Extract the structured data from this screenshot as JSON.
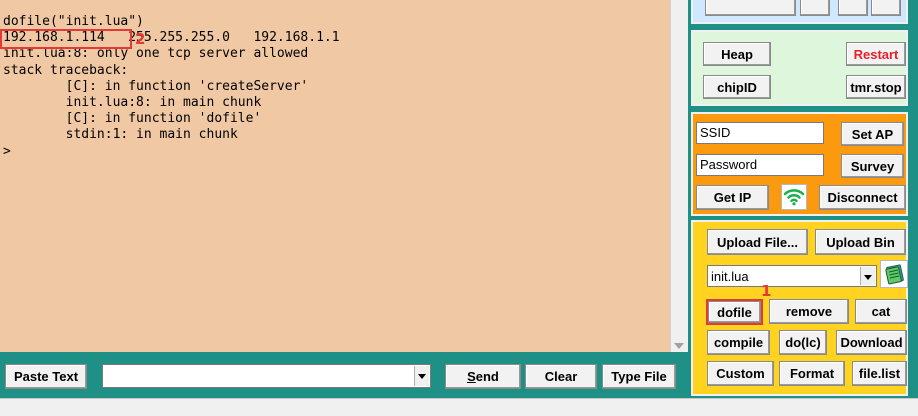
{
  "terminal": {
    "lines": [
      "dofile(\"init.lua\")",
      "192.168.1.114   255.255.255.0   192.168.1.1",
      "init.lua:8: only one tcp server allowed",
      "stack traceback:",
      "        [C]: in function 'createServer'",
      "        init.lua:8: in main chunk",
      "        [C]: in function 'dofile'",
      "        stdin:1: in main chunk",
      ">"
    ],
    "annotation_2": "2"
  },
  "bottom": {
    "paste_text": "Paste Text",
    "send_u": "S",
    "send_rest": "end",
    "clear": "Clear",
    "type_file": "Type File",
    "command_value": ""
  },
  "green_group": {
    "heap": "Heap",
    "restart": "Restart",
    "chip_id": "chipID",
    "tmr_stop": "tmr.stop"
  },
  "wifi_group": {
    "ssid_value": "SSID",
    "password_value": "Password",
    "set_ap": "Set AP",
    "survey": "Survey",
    "get_ip": "Get IP",
    "disconnect": "Disconnect"
  },
  "file_group": {
    "upload_file": "Upload File...",
    "upload_bin": "Upload Bin",
    "selected_file": "init.lua",
    "dofile": "dofile",
    "remove": "remove",
    "cat": "cat",
    "compile": "compile",
    "do_lc": "do(lc)",
    "download": "Download",
    "custom": "Custom",
    "format": "Format",
    "file_list": "file.list",
    "annotation_1": "1"
  },
  "colors": {
    "terminal_bg": "#f1c8a4",
    "teal": "#1e9086",
    "green_group": "#ddf6dc",
    "orange_group": "#fb9a0f",
    "yellow_group": "#ffd320",
    "highlight_red": "#e53935",
    "wifi_green": "#1bb14a"
  },
  "icons": [
    "wifi-icon",
    "notebook-icon",
    "dropdown-arrow-icon"
  ]
}
